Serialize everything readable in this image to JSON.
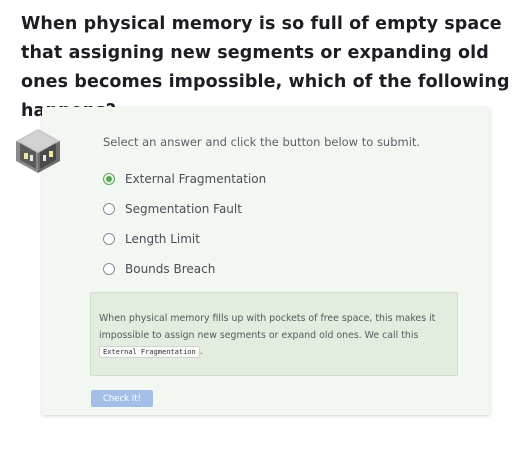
{
  "question": {
    "title": "When physical memory is so full of empty space that assigning new segments or expanding old ones becomes impossible, which of the following happens?"
  },
  "card": {
    "icon": "isometric-room-icon",
    "instructions": "Select an answer and click the button below to submit.",
    "options": [
      {
        "label": "External Fragmentation",
        "selected": true
      },
      {
        "label": "Segmentation Fault",
        "selected": false
      },
      {
        "label": "Length Limit",
        "selected": false
      },
      {
        "label": "Bounds Breach",
        "selected": false
      }
    ],
    "feedback": {
      "text": "When physical memory fills up with pockets of free space, this makes it impossible to assign new segments or expand old ones. We call this",
      "code_term": "External Fragmentation",
      "end": "."
    },
    "check_button_label": "Check It!"
  },
  "colors": {
    "accent_selected": "#5aa55a",
    "button_disabled": "#a4bfe7",
    "card_background": "#f3f7f2",
    "feedback_background": "#e2eddf"
  }
}
